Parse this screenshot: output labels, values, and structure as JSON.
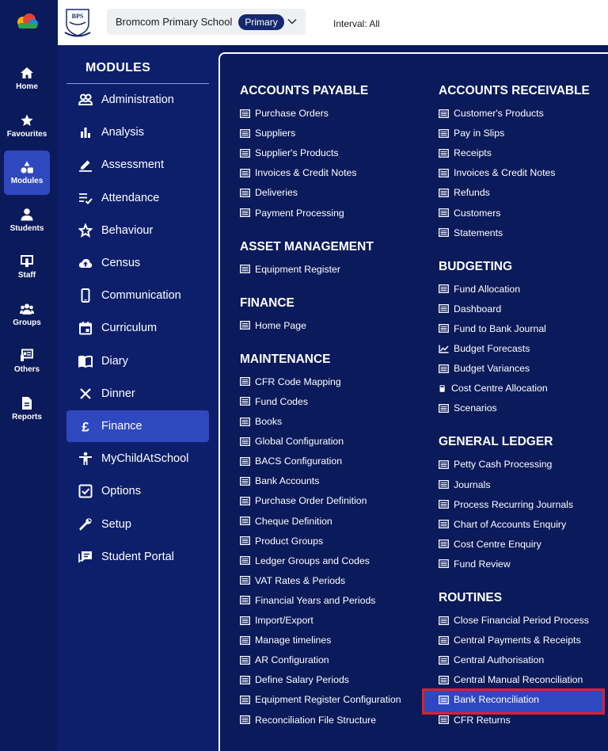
{
  "topbar": {
    "school_name": "Bromcom Primary School",
    "phase_badge": "Primary",
    "interval": "Interval: All"
  },
  "rail": [
    {
      "label": "Home",
      "icon": "home-icon"
    },
    {
      "label": "Favourites",
      "icon": "star-icon"
    },
    {
      "label": "Modules",
      "icon": "shapes-icon",
      "active": true
    },
    {
      "label": "Students",
      "icon": "person-icon"
    },
    {
      "label": "Staff",
      "icon": "teacher-board-icon"
    },
    {
      "label": "Groups",
      "icon": "group-icon"
    },
    {
      "label": "Others",
      "icon": "id-card-icon"
    },
    {
      "label": "Reports",
      "icon": "document-icon"
    }
  ],
  "modules": {
    "heading": "MODULES",
    "items": [
      {
        "label": "Administration",
        "icon": "people-icon"
      },
      {
        "label": "Analysis",
        "icon": "bar-chart-icon"
      },
      {
        "label": "Assessment",
        "icon": "pencil-icon"
      },
      {
        "label": "Attendance",
        "icon": "checklist-icon"
      },
      {
        "label": "Behaviour",
        "icon": "star-outline-icon"
      },
      {
        "label": "Census",
        "icon": "cloud-upload-icon"
      },
      {
        "label": "Communication",
        "icon": "mobile-icon"
      },
      {
        "label": "Curriculum",
        "icon": "calendar-icon"
      },
      {
        "label": "Diary",
        "icon": "book-icon"
      },
      {
        "label": "Dinner",
        "icon": "cutlery-icon"
      },
      {
        "label": "Finance",
        "icon": "pound-icon",
        "active": true
      },
      {
        "label": "MyChildAtSchool",
        "icon": "child-icon"
      },
      {
        "label": "Options",
        "icon": "checkbox-icon"
      },
      {
        "label": "Setup",
        "icon": "wrench-icon"
      },
      {
        "label": "Student Portal",
        "icon": "chat-icon"
      }
    ]
  },
  "panel": {
    "left": [
      {
        "title": "ACCOUNTS PAYABLE",
        "links": [
          "Purchase Orders",
          "Suppliers",
          "Supplier's Products",
          "Invoices & Credit Notes",
          "Deliveries",
          "Payment Processing"
        ]
      },
      {
        "title": "ASSET MANAGEMENT",
        "links": [
          "Equipment Register"
        ]
      },
      {
        "title": "FINANCE",
        "links": [
          "Home Page"
        ]
      },
      {
        "title": "MAINTENANCE",
        "links": [
          "CFR Code Mapping",
          "Fund Codes",
          "Books",
          "Global Configuration",
          "BACS Configuration",
          "Bank Accounts",
          "Purchase Order Definition",
          "Cheque Definition",
          "Product Groups",
          "Ledger Groups and Codes",
          "VAT Rates & Periods",
          "Financial Years and Periods",
          "Import/Export",
          "Manage timelines",
          "AR Configuration",
          "Define Salary Periods",
          "Equipment Register Configuration",
          "Reconciliation File Structure"
        ]
      }
    ],
    "right": [
      {
        "title": "ACCOUNTS RECEIVABLE",
        "links": [
          "Customer's Products",
          "Pay in Slips",
          "Receipts",
          "Invoices & Credit Notes",
          "Refunds",
          "Customers",
          "Statements"
        ]
      },
      {
        "title": "BUDGETING",
        "links": [
          "Fund Allocation",
          "Dashboard",
          "Fund to Bank Journal",
          "Budget Forecasts",
          "Budget Variances",
          "Cost Centre Allocation",
          "Scenarios"
        ]
      },
      {
        "title": "GENERAL LEDGER",
        "links": [
          "Petty Cash Processing",
          "Journals",
          "Process Recurring Journals",
          "Chart of Accounts Enquiry",
          "Cost Centre Enquiry",
          "Fund Review"
        ]
      },
      {
        "title": "ROUTINES",
        "links": [
          "Close Financial Period Process",
          "Central Payments & Receipts",
          "Central Authorisation",
          "Central Manual Reconciliation",
          "Bank Reconciliation",
          "CFR Returns"
        ]
      }
    ]
  }
}
